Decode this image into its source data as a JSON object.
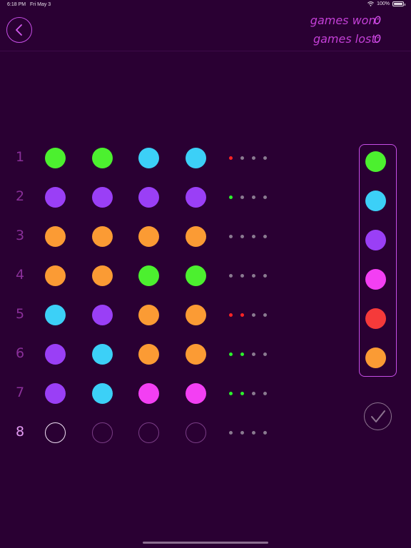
{
  "status_bar": {
    "time": "6:18 PM",
    "date": "Fri May 3",
    "battery": "100%"
  },
  "header": {
    "games_won_label": "games won:",
    "games_won_value": "0",
    "games_lost_label": "games lost:",
    "games_lost_value": "0"
  },
  "colors": {
    "green": "#4cf02f",
    "cyan": "#3cd0f7",
    "purple": "#9a3ff6",
    "magenta": "#f33ff3",
    "red": "#f53a3a",
    "orange": "#fb9b34",
    "fb_red": "#ff2424",
    "fb_green": "#2cf22c",
    "fb_empty": "#8a7a90"
  },
  "board": {
    "rows": [
      {
        "num": "1",
        "pegs": [
          "green",
          "green",
          "cyan",
          "cyan"
        ],
        "feedback": [
          "red",
          "empty",
          "empty",
          "empty"
        ]
      },
      {
        "num": "2",
        "pegs": [
          "purple",
          "purple",
          "purple",
          "purple"
        ],
        "feedback": [
          "green",
          "empty",
          "empty",
          "empty"
        ]
      },
      {
        "num": "3",
        "pegs": [
          "orange",
          "orange",
          "orange",
          "orange"
        ],
        "feedback": [
          "empty",
          "empty",
          "empty",
          "empty"
        ]
      },
      {
        "num": "4",
        "pegs": [
          "orange",
          "orange",
          "green",
          "green"
        ],
        "feedback": [
          "empty",
          "empty",
          "empty",
          "empty"
        ]
      },
      {
        "num": "5",
        "pegs": [
          "cyan",
          "purple",
          "orange",
          "orange"
        ],
        "feedback": [
          "red",
          "red",
          "empty",
          "empty"
        ]
      },
      {
        "num": "6",
        "pegs": [
          "purple",
          "cyan",
          "orange",
          "orange"
        ],
        "feedback": [
          "green",
          "green",
          "empty",
          "empty"
        ]
      },
      {
        "num": "7",
        "pegs": [
          "purple",
          "cyan",
          "magenta",
          "magenta"
        ],
        "feedback": [
          "green",
          "green",
          "empty",
          "empty"
        ]
      },
      {
        "num": "8",
        "pegs": [
          "current",
          "empty",
          "empty",
          "empty"
        ],
        "feedback": [
          "empty",
          "empty",
          "empty",
          "empty"
        ]
      }
    ]
  },
  "palette": [
    "green",
    "cyan",
    "purple",
    "magenta",
    "red",
    "orange"
  ],
  "icons": {
    "back": "chevron-left-icon",
    "submit": "checkmark-icon",
    "wifi": "wifi-icon",
    "battery": "battery-icon"
  }
}
